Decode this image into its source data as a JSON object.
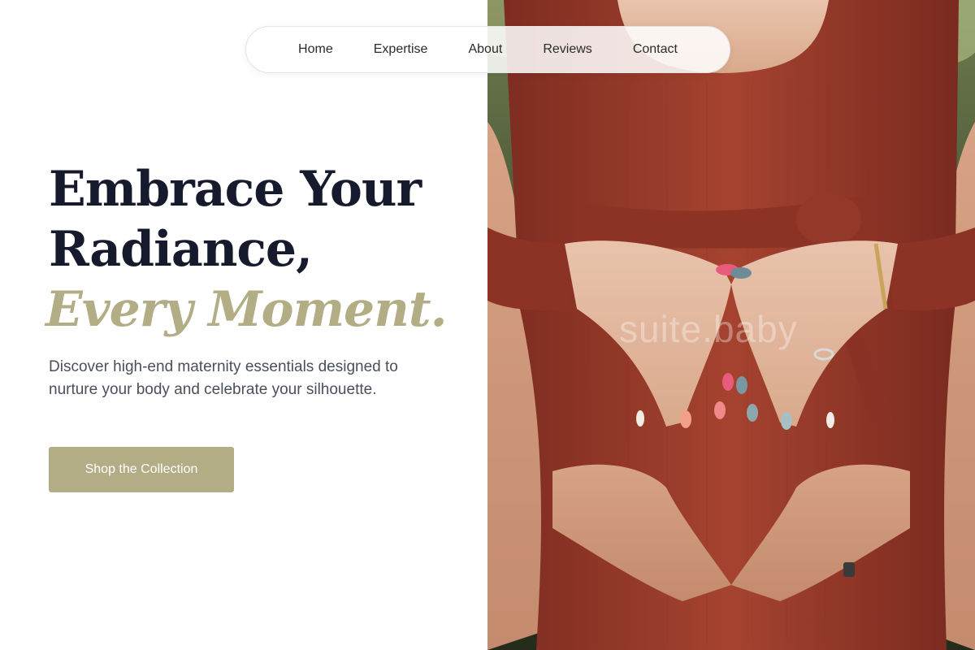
{
  "nav": {
    "items": [
      {
        "label": "Home"
      },
      {
        "label": "Expertise"
      },
      {
        "label": "About"
      },
      {
        "label": "Reviews"
      },
      {
        "label": "Contact"
      }
    ]
  },
  "hero": {
    "headline_line1": "Embrace Your",
    "headline_line2": "Radiance,",
    "headline_accent": "Every Moment.",
    "subtitle": "Discover high-end maternity essentials designed to nurture your body and celebrate your silhouette.",
    "cta_label": "Shop the Collection"
  },
  "photo": {
    "watermark": "suite.baby"
  },
  "colors": {
    "accent": "#b3ad86",
    "headline": "#151a2d",
    "body_text": "#4a4f5c",
    "dress": "#9b3b2c"
  }
}
